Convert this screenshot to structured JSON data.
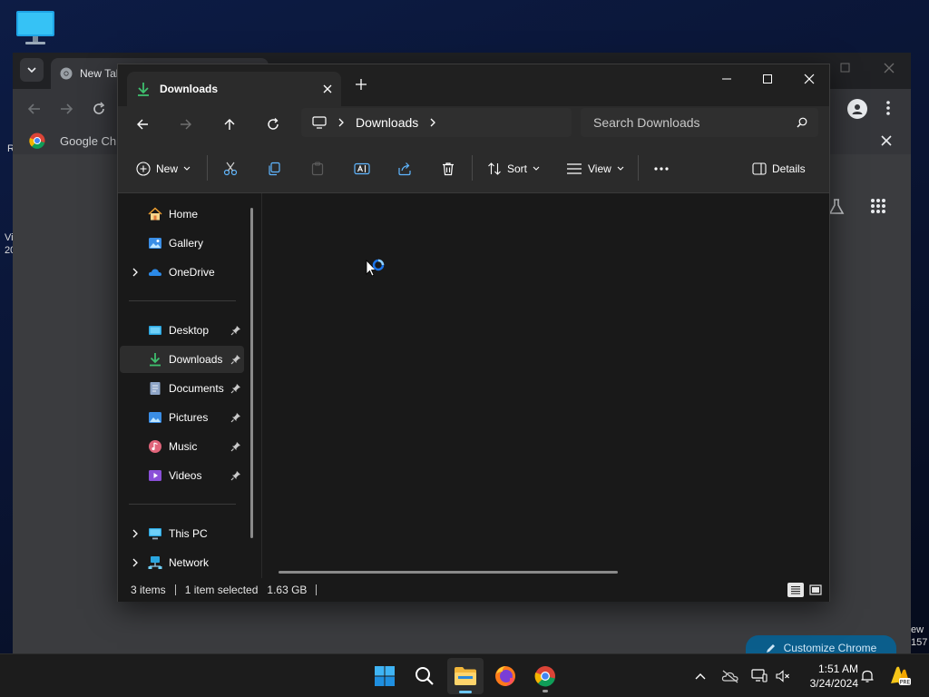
{
  "desktop": {
    "left_edge_lines": [
      "R",
      "Vi",
      "20"
    ],
    "right_edge_lines": [
      "ew",
      "157"
    ]
  },
  "chrome": {
    "tab_title": "New Tab",
    "bookmark_label": "Google Chrome",
    "customize_label": "Customize Chrome"
  },
  "explorer": {
    "tab_title": "Downloads",
    "address": {
      "segment": "Downloads"
    },
    "search_placeholder": "Search Downloads",
    "commands": {
      "new": "New",
      "sort": "Sort",
      "view": "View",
      "details": "Details"
    },
    "sidebar": {
      "quick": [
        {
          "label": "Home",
          "icon": "home-icon"
        },
        {
          "label": "Gallery",
          "icon": "gallery-icon"
        },
        {
          "label": "OneDrive",
          "icon": "onedrive-icon"
        }
      ],
      "pinned": [
        {
          "label": "Desktop",
          "icon": "desktop-folder-icon"
        },
        {
          "label": "Downloads",
          "icon": "downloads-folder-icon"
        },
        {
          "label": "Documents",
          "icon": "documents-folder-icon"
        },
        {
          "label": "Pictures",
          "icon": "pictures-folder-icon"
        },
        {
          "label": "Music",
          "icon": "music-folder-icon"
        },
        {
          "label": "Videos",
          "icon": "videos-folder-icon"
        }
      ],
      "bottom": [
        {
          "label": "This PC",
          "icon": "this-pc-icon"
        },
        {
          "label": "Network",
          "icon": "network-icon"
        }
      ],
      "selected": "Downloads"
    },
    "status": {
      "items": "3 items",
      "selection": "1 item selected",
      "size": "1.63 GB"
    }
  },
  "taskbar": {
    "apps": [
      "start-icon",
      "search-icon",
      "file-explorer-icon",
      "firefox-icon",
      "chrome-icon"
    ],
    "time": "1:51 AM",
    "date": "3/24/2024"
  },
  "colors": {
    "accent": "#4cc2ff",
    "download_green": "#3fbf6e",
    "taskbar_underline": "#6cc7f4"
  }
}
